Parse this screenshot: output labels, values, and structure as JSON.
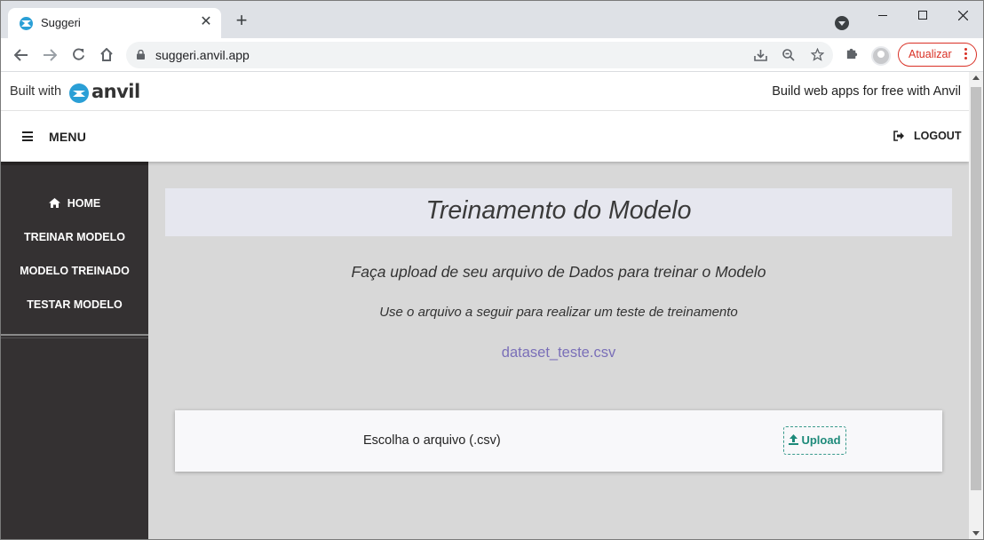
{
  "browser": {
    "tab_title": "Suggeri",
    "tab_close": "✕",
    "new_tab": "+",
    "url": "suggeri.anvil.app",
    "update_label": "Atualizar"
  },
  "banner": {
    "built_with": "Built with",
    "logo_text": "anvil",
    "promo": "Build web apps for free with Anvil"
  },
  "appbar": {
    "menu_label": "MENU",
    "logout_label": "LOGOUT"
  },
  "sidebar": {
    "items": [
      {
        "label": "HOME",
        "icon": "home-icon"
      },
      {
        "label": "TREINAR MODELO"
      },
      {
        "label": "MODELO TREINADO"
      },
      {
        "label": "TESTAR MODELO"
      }
    ]
  },
  "main": {
    "title": "Treinamento do Modelo",
    "subtitle": "Faça upload de seu arquivo de Dados para treinar o Modelo",
    "hint": "Use o arquivo a seguir para realizar um teste de treinamento",
    "dataset_link": "dataset_teste.csv",
    "choose_file_label": "Escolha o arquivo (.csv)",
    "upload_label": "Upload"
  },
  "colors": {
    "sidebar_bg": "#343132",
    "content_bg": "#d8d8d8",
    "accent_link": "#7a6fb8",
    "upload_accent": "#1d8a7a",
    "update_red": "#d93025"
  }
}
